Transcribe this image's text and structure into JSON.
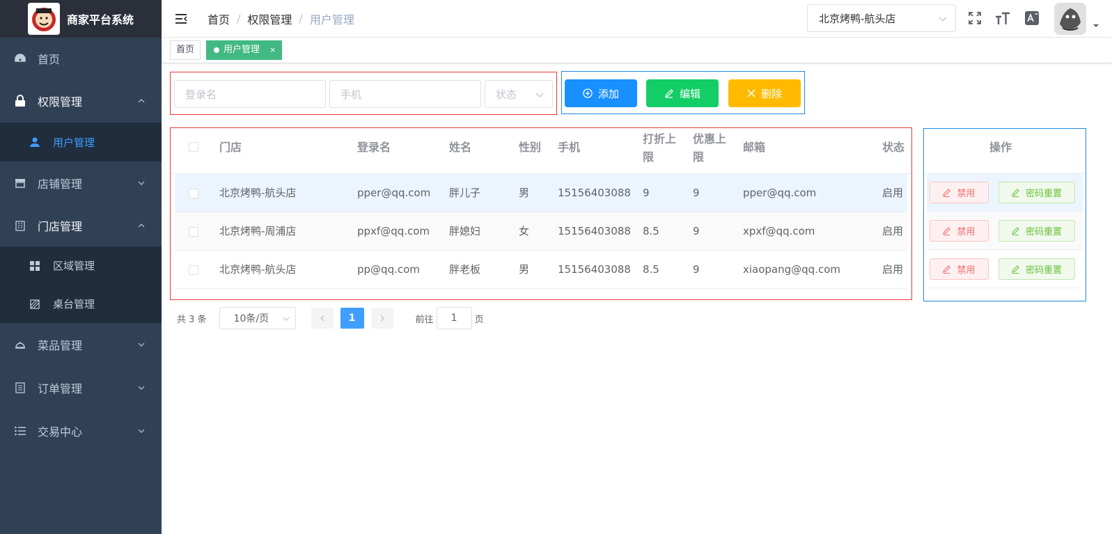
{
  "app": {
    "title": "商家平台系统"
  },
  "sidebar": {
    "items": [
      {
        "label": "首页",
        "icon": "dashboard-icon"
      },
      {
        "label": "权限管理",
        "icon": "lock-icon",
        "expanded": true,
        "children": [
          {
            "label": "用户管理",
            "icon": "user-icon",
            "active": true
          }
        ]
      },
      {
        "label": "店铺管理",
        "icon": "shop-icon"
      },
      {
        "label": "门店管理",
        "icon": "building-icon",
        "expanded": true,
        "children": [
          {
            "label": "区域管理",
            "icon": "grid-icon"
          },
          {
            "label": "桌台管理",
            "icon": "table-icon"
          }
        ]
      },
      {
        "label": "菜品管理",
        "icon": "dish-icon"
      },
      {
        "label": "订单管理",
        "icon": "order-icon"
      },
      {
        "label": "交易中心",
        "icon": "list-icon"
      }
    ]
  },
  "header": {
    "breadcrumb": [
      "首页",
      "权限管理",
      "用户管理"
    ],
    "store_selected": "北京烤鸭-航头店"
  },
  "tags": [
    {
      "label": "首页",
      "active": false
    },
    {
      "label": "用户管理",
      "active": true,
      "close": "×"
    }
  ],
  "search": {
    "login_placeholder": "登录名",
    "phone_placeholder": "手机",
    "status_placeholder": "状态"
  },
  "actions": {
    "add": "添加",
    "edit": "编辑",
    "delete": "删除"
  },
  "table": {
    "headers": {
      "store": "门店",
      "login": "登录名",
      "name": "姓名",
      "gender": "性别",
      "phone": "手机",
      "discount_l1": "打折上",
      "discount_l2": "限",
      "coupon_l1": "优惠上",
      "coupon_l2": "限",
      "email": "邮箱",
      "status": "状态",
      "ops": "操作"
    },
    "rows": [
      {
        "store": "北京烤鸭-航头店",
        "login": "pper@qq.com",
        "name": "胖儿子",
        "gender": "男",
        "phone": "15156403088",
        "discount": "9",
        "coupon": "9",
        "email": "pper@qq.com",
        "status": "启用"
      },
      {
        "store": "北京烤鸭-周浦店",
        "login": "ppxf@qq.com",
        "name": "胖媳妇",
        "gender": "女",
        "phone": "15156403088",
        "discount": "8.5",
        "coupon": "9",
        "email": "xpxf@qq.com",
        "status": "启用"
      },
      {
        "store": "北京烤鸭-航头店",
        "login": "pp@qq.com",
        "name": "胖老板",
        "gender": "男",
        "phone": "15156403088",
        "discount": "8.5",
        "coupon": "9",
        "email": "xiaopang@qq.com",
        "status": "启用"
      }
    ],
    "op_disable": "禁用",
    "op_reset": "密码重置"
  },
  "pagination": {
    "total": "共 3 条",
    "page_size": "10条/页",
    "current": "1",
    "goto_prefix": "前往",
    "goto_value": "1",
    "goto_suffix": "页"
  },
  "colors": {
    "sidebar_bg": "#304156",
    "primary": "#1890ff",
    "success": "#13ce66",
    "warning": "#ffba00",
    "tag_active": "#42b983"
  }
}
